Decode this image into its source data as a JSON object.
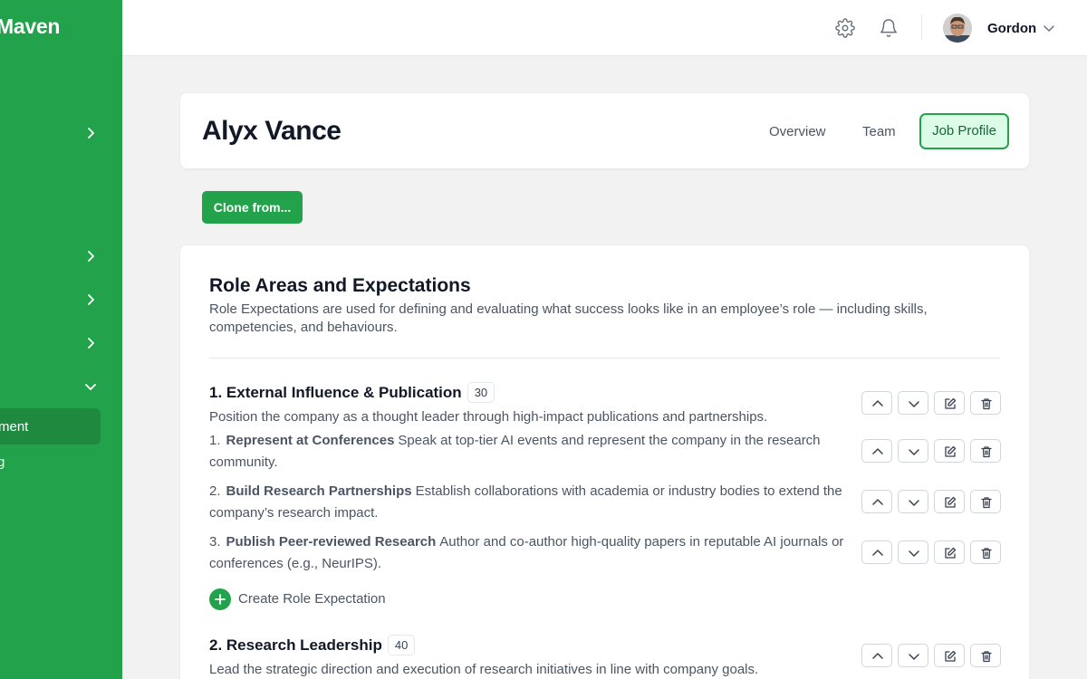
{
  "app": {
    "brand": "Maven"
  },
  "sidebar": {
    "active_item": "ment",
    "sub_item": "g"
  },
  "header": {
    "icons": [
      "gear-icon",
      "bell-icon"
    ],
    "user_name": "Gordon"
  },
  "profile": {
    "name": "Alyx Vance",
    "tabs": [
      {
        "label": "Overview",
        "active": false
      },
      {
        "label": "Team",
        "active": false
      },
      {
        "label": "Job Profile",
        "active": true
      }
    ]
  },
  "clone_button": "Clone from...",
  "section": {
    "title": "Role Areas and Expectations",
    "description": "Role Expectations are used for defining and evaluating what success looks like in an employee’s role — including skills, competencies, and behaviours."
  },
  "areas": [
    {
      "title": "1. External Influence & Publication",
      "count": "30",
      "description": "Position the company as a thought leader through high-impact publications and partnerships.",
      "expectations": [
        {
          "number": "1.",
          "name": "Represent at Conferences",
          "text": "Speak at top-tier AI events and represent the company in the research community."
        },
        {
          "number": "2.",
          "name": "Build Research Partnerships",
          "text": "Establish collaborations with academia or industry bodies to extend the company’s research impact."
        },
        {
          "number": "3.",
          "name": "Publish Peer-reviewed Research",
          "text": "Author and co-author high-quality papers in reputable AI journals or conferences (e.g., NeurIPS)."
        }
      ],
      "create_label": "Create Role Expectation"
    },
    {
      "title": "2. Research Leadership",
      "count": "40",
      "description": "Lead the strategic direction and execution of research initiatives in line with company goals."
    }
  ],
  "colors": {
    "accent": "#22a24a",
    "accent_dark": "#1e8a3f",
    "accent_light": "#dcfce7"
  }
}
